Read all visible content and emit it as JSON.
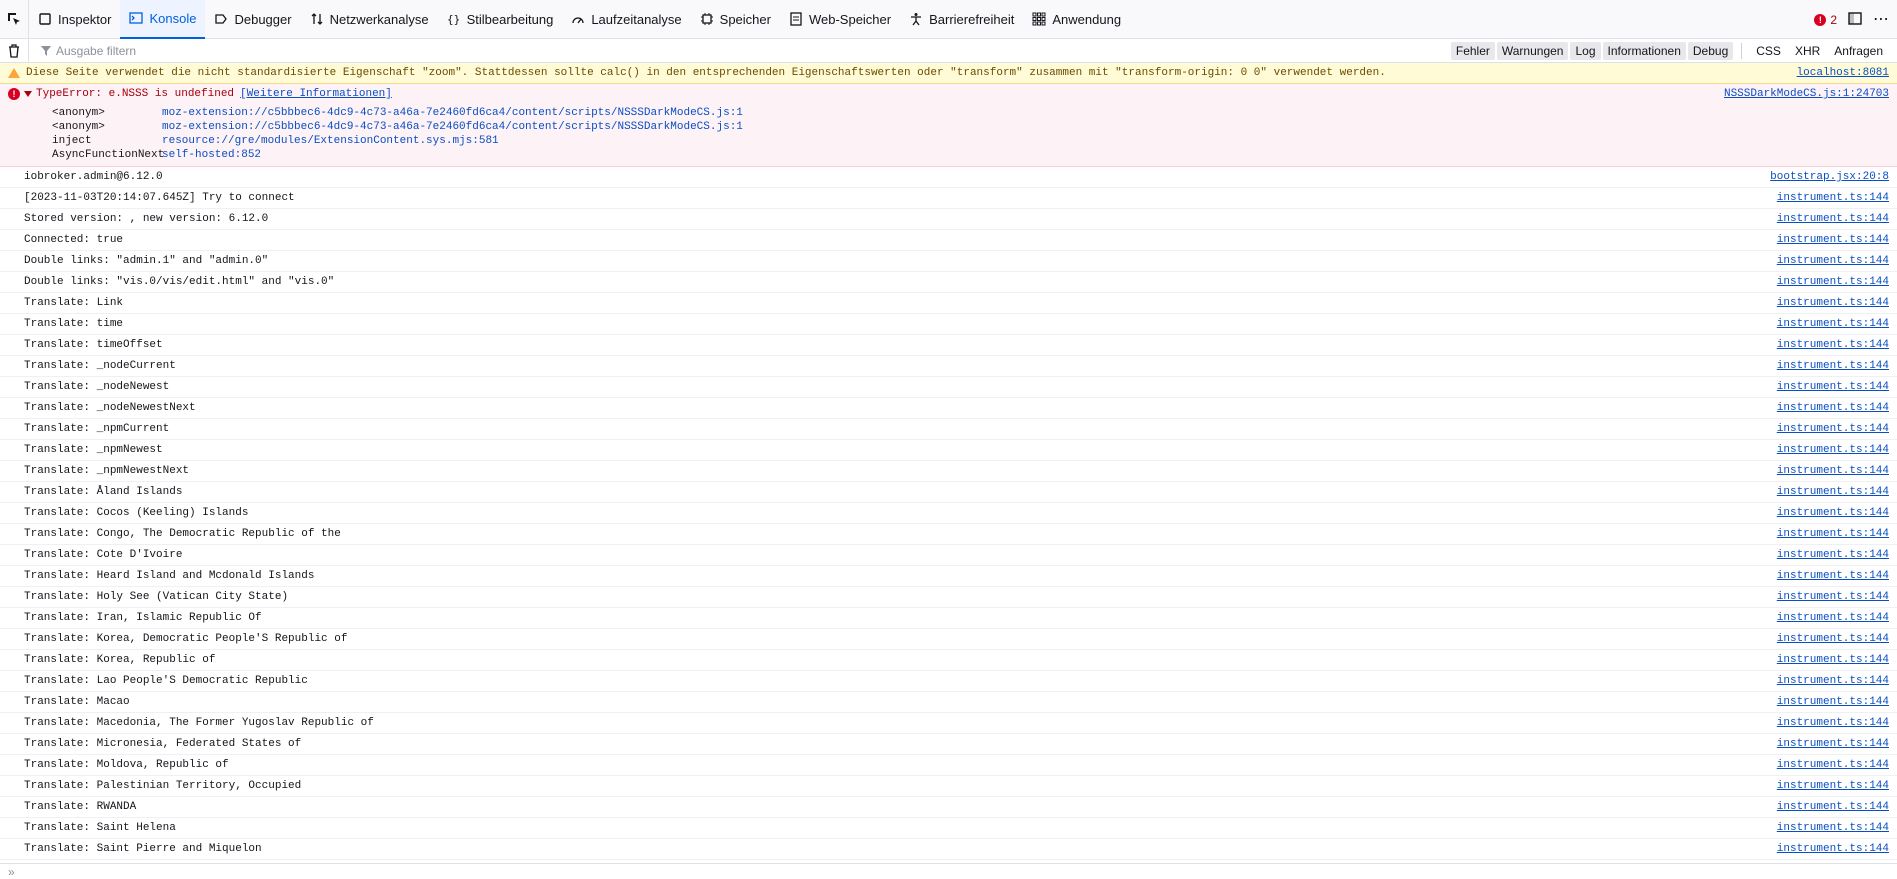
{
  "tabs": [
    {
      "label": "Inspektor",
      "icon": "inspector-icon"
    },
    {
      "label": "Konsole",
      "icon": "console-icon",
      "active": true
    },
    {
      "label": "Debugger",
      "icon": "debugger-icon"
    },
    {
      "label": "Netzwerkanalyse",
      "icon": "network-icon"
    },
    {
      "label": "Stilbearbeitung",
      "icon": "style-editor-icon"
    },
    {
      "label": "Laufzeitanalyse",
      "icon": "performance-icon"
    },
    {
      "label": "Speicher",
      "icon": "memory-icon"
    },
    {
      "label": "Web-Speicher",
      "icon": "storage-icon"
    },
    {
      "label": "Barrierefreiheit",
      "icon": "accessibility-icon"
    },
    {
      "label": "Anwendung",
      "icon": "application-icon"
    }
  ],
  "error_count": "2",
  "filter": {
    "placeholder": "Ausgabe filtern"
  },
  "filter_buttons": [
    "Fehler",
    "Warnungen",
    "Log",
    "Informationen",
    "Debug"
  ],
  "request_buttons": [
    "CSS",
    "XHR",
    "Anfragen"
  ],
  "warning": {
    "text": "Diese Seite verwendet die nicht standardisierte Eigenschaft \"zoom\". Stattdessen sollte calc() in den entsprechenden Eigenschaftswerten oder \"transform\" zusammen mit \"transform-origin: 0 0\" verwendet werden.",
    "source": "localhost:8081"
  },
  "error": {
    "text": "TypeError: e.NSSS is undefined",
    "more": "[Weitere Informationen]",
    "source": "NSSSDarkModeCS.js:1:24703",
    "stack": [
      {
        "fn": "<anonym>",
        "loc": "moz-extension://c5bbbec6-4dc9-4c73-a46a-7e2460fd6ca4/content/scripts/NSSSDarkModeCS.js:1"
      },
      {
        "fn": "<anonym>",
        "loc": "moz-extension://c5bbbec6-4dc9-4c73-a46a-7e2460fd6ca4/content/scripts/NSSSDarkModeCS.js:1"
      },
      {
        "fn": "inject",
        "loc": "resource://gre/modules/ExtensionContent.sys.mjs:581"
      },
      {
        "fn": "AsyncFunctionNext",
        "loc": "self-hosted:852"
      }
    ]
  },
  "logs": [
    {
      "text": "iobroker.admin@6.12.0",
      "source": "bootstrap.jsx:20:8"
    },
    {
      "text": "[2023-11-03T20:14:07.645Z] Try to connect",
      "source": "instrument.ts:144"
    },
    {
      "text": "Stored version: , new version: 6.12.0",
      "source": "instrument.ts:144"
    },
    {
      "text": "Connected: true",
      "source": "instrument.ts:144"
    },
    {
      "text": "Double links: \"admin.1\" and \"admin.0\"",
      "source": "instrument.ts:144"
    },
    {
      "text": "Double links: \"vis.0/vis/edit.html\" and \"vis.0\"",
      "source": "instrument.ts:144"
    },
    {
      "text": "Translate: Link",
      "source": "instrument.ts:144"
    },
    {
      "text": "Translate: time",
      "source": "instrument.ts:144"
    },
    {
      "text": "Translate: timeOffset",
      "source": "instrument.ts:144"
    },
    {
      "text": "Translate: _nodeCurrent",
      "source": "instrument.ts:144"
    },
    {
      "text": "Translate: _nodeNewest",
      "source": "instrument.ts:144"
    },
    {
      "text": "Translate: _nodeNewestNext",
      "source": "instrument.ts:144"
    },
    {
      "text": "Translate: _npmCurrent",
      "source": "instrument.ts:144"
    },
    {
      "text": "Translate: _npmNewest",
      "source": "instrument.ts:144"
    },
    {
      "text": "Translate: _npmNewestNext",
      "source": "instrument.ts:144"
    },
    {
      "text": "Translate: Åland Islands",
      "source": "instrument.ts:144"
    },
    {
      "text": "Translate: Cocos (Keeling) Islands",
      "source": "instrument.ts:144"
    },
    {
      "text": "Translate: Congo, The Democratic Republic of the",
      "source": "instrument.ts:144"
    },
    {
      "text": "Translate: Cote D'Ivoire",
      "source": "instrument.ts:144"
    },
    {
      "text": "Translate: Heard Island and Mcdonald Islands",
      "source": "instrument.ts:144"
    },
    {
      "text": "Translate: Holy See (Vatican City State)",
      "source": "instrument.ts:144"
    },
    {
      "text": "Translate: Iran, Islamic Republic Of",
      "source": "instrument.ts:144"
    },
    {
      "text": "Translate: Korea, Democratic People'S Republic of",
      "source": "instrument.ts:144"
    },
    {
      "text": "Translate: Korea, Republic of",
      "source": "instrument.ts:144"
    },
    {
      "text": "Translate: Lao People'S Democratic Republic",
      "source": "instrument.ts:144"
    },
    {
      "text": "Translate: Macao",
      "source": "instrument.ts:144"
    },
    {
      "text": "Translate: Macedonia, The Former Yugoslav Republic of",
      "source": "instrument.ts:144"
    },
    {
      "text": "Translate: Micronesia, Federated States of",
      "source": "instrument.ts:144"
    },
    {
      "text": "Translate: Moldova, Republic of",
      "source": "instrument.ts:144"
    },
    {
      "text": "Translate: Palestinian Territory, Occupied",
      "source": "instrument.ts:144"
    },
    {
      "text": "Translate: RWANDA",
      "source": "instrument.ts:144"
    },
    {
      "text": "Translate: Saint Helena",
      "source": "instrument.ts:144"
    },
    {
      "text": "Translate: Saint Pierre and Miquelon",
      "source": "instrument.ts:144"
    }
  ],
  "prompt": "»"
}
